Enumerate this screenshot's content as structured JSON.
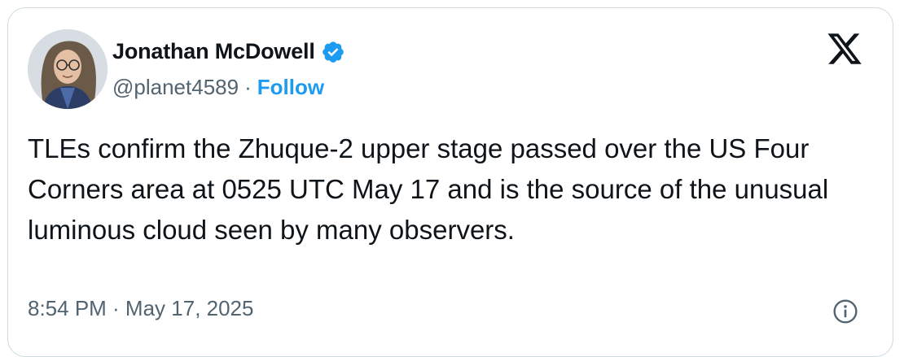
{
  "author": {
    "display_name": "Jonathan McDowell",
    "handle": "@planet4589",
    "separator": "·",
    "follow_label": "Follow",
    "verified": true
  },
  "tweet": {
    "text": "TLEs confirm the Zhuque-2 upper stage passed over the US Four Corners area at 0525 UTC May 17 and is the source of the unusual luminous cloud seen by many observers.",
    "timestamp": "8:54 PM · May 17, 2025"
  },
  "icons": {
    "verified": "verified-badge-icon",
    "platform": "x-logo-icon",
    "info": "info-icon"
  },
  "colors": {
    "accent": "#1d9bf0",
    "text": "#0f1419",
    "secondary": "#536471",
    "border": "#cfd9de"
  }
}
